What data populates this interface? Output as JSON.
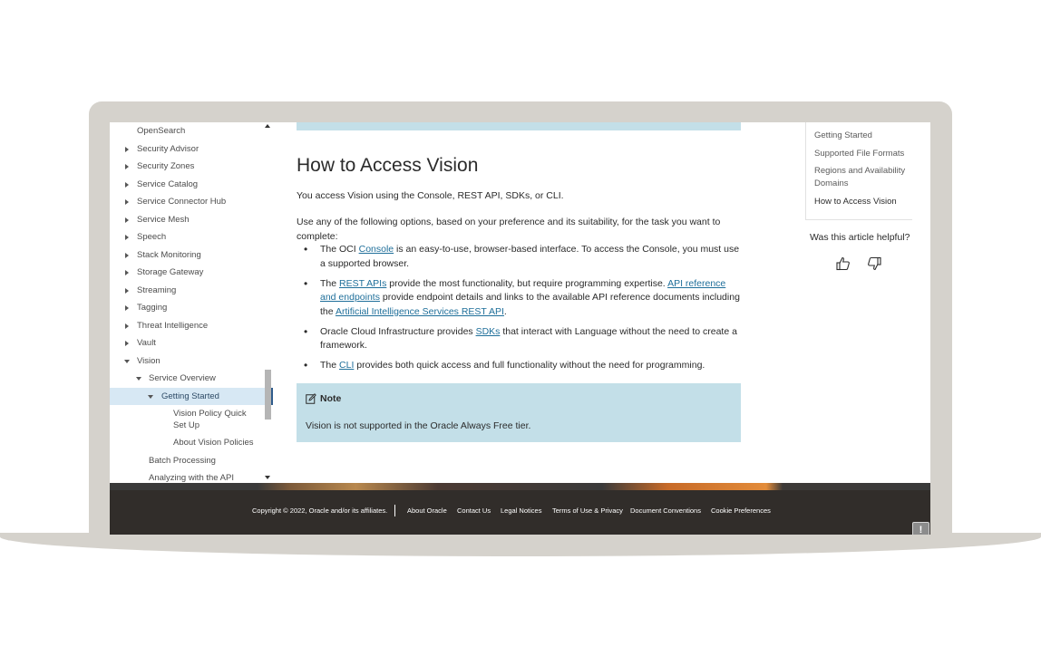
{
  "sidebar": {
    "items": [
      {
        "label": "OpenSearch"
      },
      {
        "label": "Security Advisor"
      },
      {
        "label": "Security Zones"
      },
      {
        "label": "Service Catalog"
      },
      {
        "label": "Service Connector Hub"
      },
      {
        "label": "Service Mesh"
      },
      {
        "label": "Speech"
      },
      {
        "label": "Stack Monitoring"
      },
      {
        "label": "Storage Gateway"
      },
      {
        "label": "Streaming"
      },
      {
        "label": "Tagging"
      },
      {
        "label": "Threat Intelligence"
      },
      {
        "label": "Vault"
      },
      {
        "label": "Vision"
      },
      {
        "label": "Service Overview"
      },
      {
        "label": "Getting Started"
      },
      {
        "label": "Vision Policy Quick Set Up"
      },
      {
        "label": "About Vision Policies"
      },
      {
        "label": "Batch Processing"
      },
      {
        "label": "Analyzing with the API"
      }
    ]
  },
  "article": {
    "title": "How to Access Vision",
    "intro": "You access Vision using the Console, REST API, SDKs, or CLI.",
    "options_intro": "Use any of the following options, based on your preference and its suitability, for the task you want to complete:",
    "bullets": {
      "b1_pre": "The OCI ",
      "b1_link": "Console",
      "b1_post": " is an easy-to-use, browser-based interface. To access the Console, you must use a supported browser.",
      "b2_pre": "The ",
      "b2_link1": "REST APIs",
      "b2_mid": " provide the most functionality, but require programming expertise. ",
      "b2_link2": "API reference and endpoints",
      "b2_mid2": " provide endpoint details and links to the available API reference documents including the ",
      "b2_link3": "Artificial Intelligence Services REST API",
      "b2_post": ".",
      "b3_pre": "Oracle Cloud Infrastructure provides ",
      "b3_link": "SDKs",
      "b3_post": " that interact with Language without the need to create a framework.",
      "b4_pre": "The ",
      "b4_link": "CLI",
      "b4_post": " provides both quick access and full functionality without the need for programming."
    },
    "note_heading": "Note",
    "note_text": "Vision is not supported in the Oracle Always Free tier."
  },
  "toc": {
    "items": [
      {
        "label": "Getting Started"
      },
      {
        "label": "Supported File Formats"
      },
      {
        "label": "Regions and Availability Domains"
      },
      {
        "label": "How to Access Vision"
      }
    ],
    "helpful_question": "Was this article helpful?"
  },
  "footer": {
    "copyright": "Copyright © 2022, Oracle and/or its affiliates.",
    "links": [
      {
        "label": "About Oracle"
      },
      {
        "label": "Contact Us"
      },
      {
        "label": "Legal Notices"
      },
      {
        "label": "Terms of Use & Privacy"
      },
      {
        "label": "Document Conventions"
      },
      {
        "label": "Cookie Preferences"
      }
    ],
    "feedback_label": "!"
  },
  "colors": {
    "note_background": "#c3dfe8",
    "link": "#1f6f9a",
    "footer_background": "#312d2a",
    "active_nav": "#d7e8f4"
  }
}
